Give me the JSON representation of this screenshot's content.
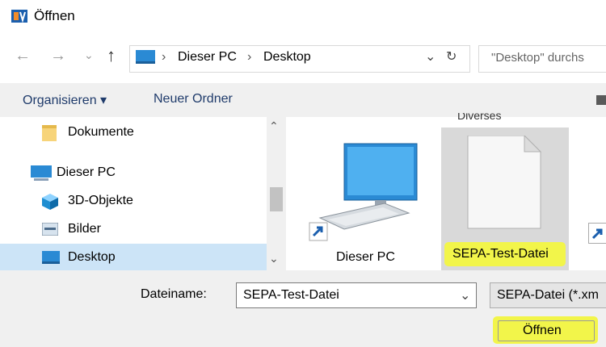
{
  "window": {
    "title": "Öffnen"
  },
  "addressbar": {
    "crumbs": [
      "Dieser PC",
      "Desktop"
    ],
    "separator": "›",
    "search_placeholder": "\"Desktop\" durchs"
  },
  "toolbar": {
    "organize": "Organisieren ▾",
    "new_folder": "Neuer Ordner"
  },
  "nav_pane": {
    "items": [
      {
        "label": "Dokumente",
        "icon": "folder-icon"
      },
      {
        "label": "Dieser PC",
        "icon": "computer-icon"
      },
      {
        "label": "3D-Objekte",
        "icon": "cube-icon"
      },
      {
        "label": "Bilder",
        "icon": "pictures-icon"
      },
      {
        "label": "Desktop",
        "icon": "desktop-icon",
        "selected": true
      }
    ]
  },
  "content": {
    "partial_header": "Diverses",
    "items": [
      {
        "label": "Dieser PC",
        "icon": "computer-shortcut-icon"
      },
      {
        "label": "SEPA-Test-Datei",
        "icon": "file-icon",
        "selected": true
      }
    ]
  },
  "footer": {
    "filename_label": "Dateiname:",
    "filename_value": "SEPA-Test-Datei",
    "filetype_value": "SEPA-Datei (*.xm",
    "open_button": "Öffnen"
  },
  "colors": {
    "highlight": "#f2f54a",
    "selection": "#cce4f7",
    "link": "#1f3b6b"
  }
}
